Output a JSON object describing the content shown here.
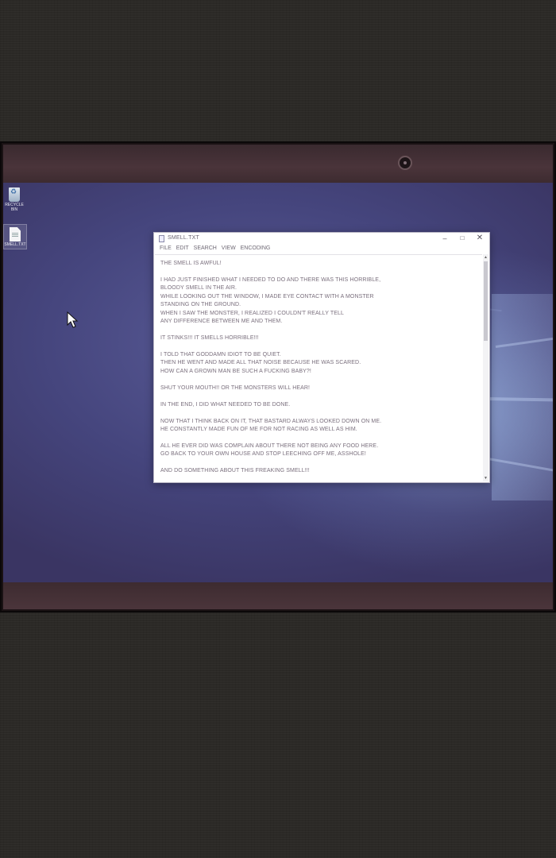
{
  "desktop": {
    "icons": [
      {
        "label": "RECYCLE BIN",
        "icon": "recycle-bin-icon"
      },
      {
        "label": "SMELL.TXT",
        "icon": "text-file-icon"
      }
    ]
  },
  "window": {
    "title": "SMELL.TXT",
    "controls": {
      "minimize": "–",
      "maximize": "□",
      "close": "✕"
    },
    "menu": [
      "FILE",
      "EDIT",
      "SEARCH",
      "VIEW",
      "ENCODING"
    ],
    "lines": [
      "THE SMELL IS AWFUL!",
      "I HAD JUST FINISHED WHAT I NEEDED TO DO AND THERE WAS THIS HORRIBLE,",
      "BLOODY SMELL IN THE AIR.",
      "WHILE LOOKING OUT THE WINDOW, I MADE EYE CONTACT WITH A MONSTER",
      "STANDING ON THE GROUND.",
      "WHEN I SAW THE MONSTER, I REALIZED I COULDN'T REALLY TELL",
      "ANY DIFFERENCE BETWEEN ME AND THEM.",
      "IT STINKS!!! IT SMELLS HORRIBLE!!!",
      "I TOLD THAT GODDAMN IDIOT TO BE QUIET.",
      "THEN HE WENT AND MADE ALL THAT NOISE BECAUSE HE WAS SCARED.",
      "HOW CAN A GROWN MAN BE SUCH A FUCKING BABY?!",
      "SHUT YOUR MOUTH!! OR THE MONSTERS WILL HEAR!",
      "IN THE END, I DID WHAT NEEDED TO BE DONE.",
      "NOW THAT I THINK BACK ON IT, THAT BASTARD ALWAYS LOOKED DOWN ON ME.",
      "HE CONSTANTLY MADE FUN OF ME FOR NOT RACING AS WELL AS HIM.",
      "ALL HE EVER DID WAS COMPLAIN ABOUT THERE NOT BEING ANY FOOD HERE.",
      "GO BACK TO YOUR OWN HOUSE AND STOP LEECHING OFF ME, ASSHOLE!",
      "AND DO SOMETHING ABOUT THIS FREAKING SMELL!!!"
    ]
  },
  "colors": {
    "desktop_bg": "#45457d",
    "bezel": "#4a343a",
    "text": "#7a6f7d"
  }
}
